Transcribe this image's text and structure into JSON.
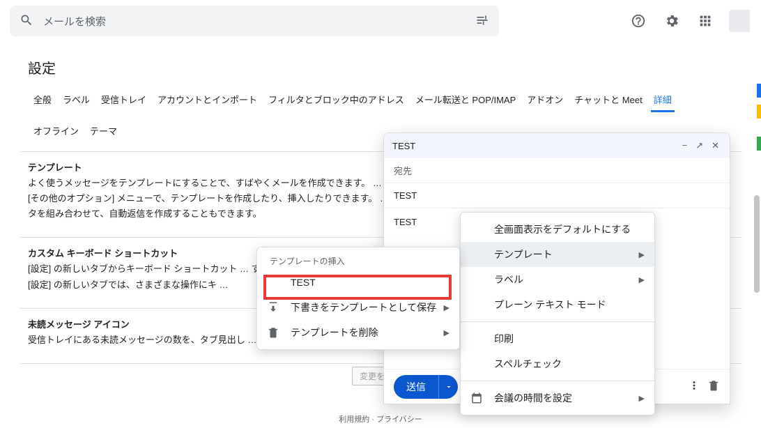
{
  "search": {
    "placeholder": "メールを検索"
  },
  "settings": {
    "title": "設定",
    "tabs": [
      "全般",
      "ラベル",
      "受信トレイ",
      "アカウントとインポート",
      "フィルタとブロック中のアドレス",
      "メール転送と POP/IMAP",
      "アドオン",
      "チャットと Meet",
      "詳細"
    ],
    "tabs_row2": [
      "オフライン",
      "テーマ"
    ],
    "active_tab_index": 8
  },
  "sections": {
    "templates": {
      "title": "テンプレート",
      "body": "よく使うメッセージをテンプレートにすることで、すばやくメールを作成できます。 … [その他のオプション] メニューで、テンプレートを作成したり、挿入したりできます。 … タを組み合わせて、自動返信を作成することもできます。"
    },
    "custom_kb": {
      "title": "カスタム キーボード ショートカット",
      "body": "[設定] の新しいタブからキーボード ショートカット … す。[設定] の新しいタブでは、さまざまな操作にキ …"
    },
    "unread_icon": {
      "title": "未読メッセージ アイコン",
      "body": "受信トレイにある未読メッセージの数を、タブ見出し …"
    },
    "save_button": "変更を保存",
    "footer": "利用規約 · プライバシー"
  },
  "compose": {
    "subject": "TEST",
    "to_placeholder": "宛先",
    "subject_field": "TEST",
    "body": "TEST",
    "send": "送信"
  },
  "menu_main": {
    "items": [
      {
        "label": "全画面表示をデフォルトにする",
        "submenu": false
      },
      {
        "label": "テンプレート",
        "submenu": true,
        "hovered": true
      },
      {
        "label": "ラベル",
        "submenu": true
      },
      {
        "label": "プレーン テキスト モード",
        "submenu": false
      },
      {
        "divider": true
      },
      {
        "label": "印刷",
        "submenu": false
      },
      {
        "label": "スペルチェック",
        "submenu": false
      },
      {
        "divider": true
      },
      {
        "label": "会議の時間を設定",
        "submenu": true,
        "icon": "calendar"
      }
    ]
  },
  "menu_sub": {
    "header": "テンプレートの挿入",
    "items": [
      {
        "label": "TEST"
      },
      {
        "label": "下書きをテンプレートとして保存",
        "submenu": true,
        "icon": "download"
      },
      {
        "label": "テンプレートを削除",
        "submenu": true,
        "icon": "trash"
      }
    ]
  }
}
